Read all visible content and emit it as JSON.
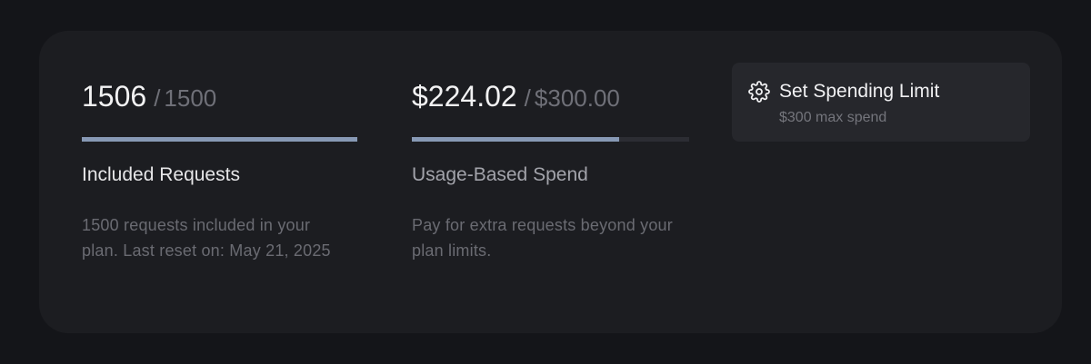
{
  "colors": {
    "page_background": "#141519",
    "card_background": "#1c1d21",
    "bar_fill": "#8799b5",
    "bar_track": "#2c2d33",
    "button_background": "#26272c"
  },
  "included_requests": {
    "used": "1506",
    "separator": "/",
    "limit": "1500",
    "progress": 1.0,
    "label": "Included Requests",
    "description": "1500 requests included in your plan. Last reset on: May 21, 2025"
  },
  "usage_spend": {
    "used": "$224.02",
    "separator": "/",
    "limit": "$300.00",
    "progress": 0.7467,
    "label": "Usage-Based Spend",
    "description": "Pay for extra requests beyond your plan limits."
  },
  "spending_limit_button": {
    "icon": "gear-icon",
    "title": "Set Spending Limit",
    "subtitle": "$300 max spend"
  }
}
